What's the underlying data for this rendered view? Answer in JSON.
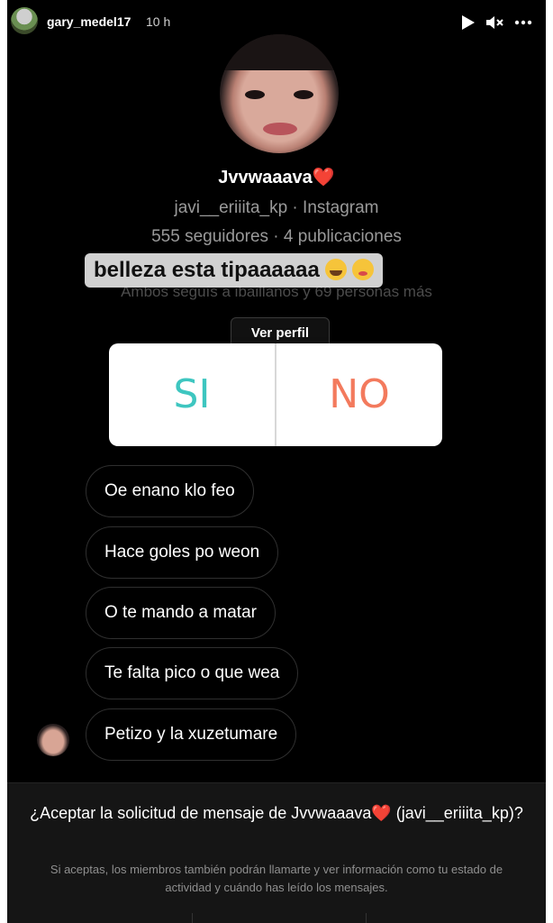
{
  "story": {
    "username": "gary_medel17",
    "time": "10 h",
    "icons": [
      "play-icon",
      "mute-icon",
      "more-icon"
    ]
  },
  "profile": {
    "name": "Jvvwaaava",
    "name_emoji": "❤️",
    "handle_line": "javi__eriiita_kp · Instagram",
    "stats": "555 seguidores · 4 publicaciones",
    "mutual": "Ambos seguís a ibaillanos y 69 personas más",
    "view_profile_label": "Ver perfil"
  },
  "caption": {
    "text": "belleza esta tipaaaaaa",
    "emojis": [
      "face-with-tears-of-joy",
      "zany-face"
    ]
  },
  "poll": {
    "option_yes": "SI",
    "option_no": "NO",
    "colors": {
      "yes": "#3ec6c0",
      "no": "#f37a5d"
    }
  },
  "messages": [
    "Oe enano klo feo",
    "Hace goles po weon",
    "O te mando a matar",
    "Te falta pico o que wea",
    "Petizo y la xuzetumare"
  ],
  "request": {
    "title": "¿Aceptar la solicitud de mensaje de Jvvwaaava❤️ (javi__eriiita_kp)?",
    "info": "Si aceptas, los miembros también podrán llamarte y ver información como tu estado de actividad y cuándo has leído los mensajes."
  }
}
